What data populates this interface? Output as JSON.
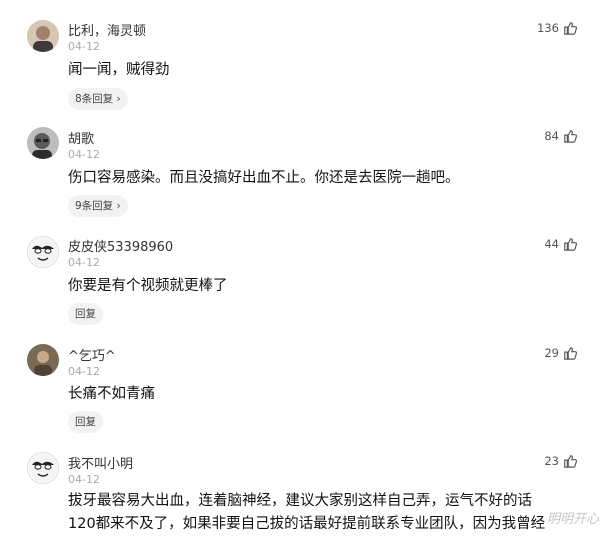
{
  "comments": [
    {
      "name": "比利，海灵顿",
      "date": "04-12",
      "lines": [
        "闻一闻，贼得劲"
      ],
      "reply": "8条回复 ›",
      "likes": "136",
      "avatar_icon": "man-portrait-avatar-icon"
    },
    {
      "name": "胡歌",
      "date": "04-12",
      "lines": [
        "伤口容易感染。而且没搞好出血不止。你还是去医院一趟吧。"
      ],
      "reply": "9条回复 ›",
      "likes": "84",
      "avatar_icon": "man-glasses-avatar-icon"
    },
    {
      "name": "皮皮侠53398960",
      "date": "04-12",
      "lines": [
        "你要是有个视频就更棒了"
      ],
      "reply": "回复",
      "likes": "44",
      "avatar_icon": "cartoon-face-avatar-icon"
    },
    {
      "name": "^乞巧^",
      "date": "04-12",
      "lines": [
        "长痛不如青痛"
      ],
      "reply": "回复",
      "likes": "29",
      "avatar_icon": "photo-avatar-icon"
    },
    {
      "name": "我不叫小明",
      "date": "04-12",
      "lines": [
        "拔牙最容易大出血，连着脑神经，建议大家别这样自己弄，运气不好的话",
        "120都来不及了，如果非要自己拔的话最好提前联系专业团队，因为我曾经"
      ],
      "reply": "",
      "likes": "23",
      "avatar_icon": "cartoon-face-avatar-icon"
    }
  ],
  "watermark": "明明开心"
}
